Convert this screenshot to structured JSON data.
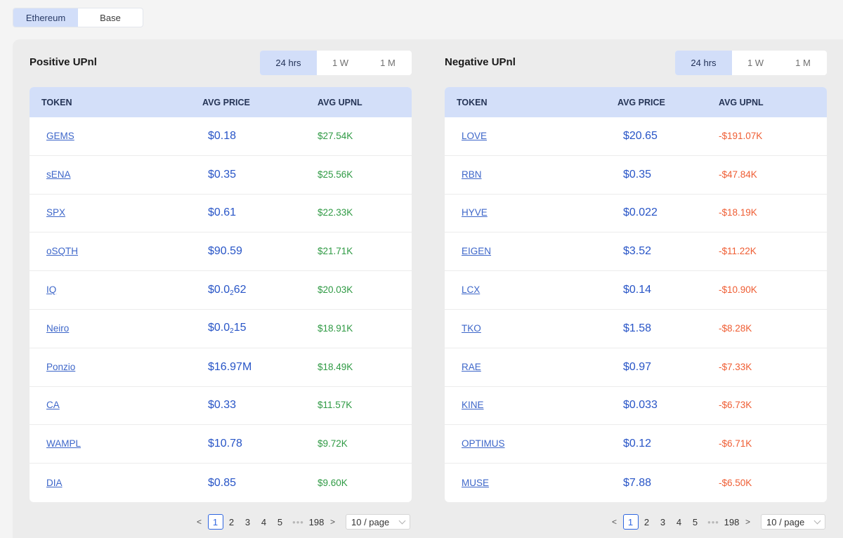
{
  "network_tabs": [
    {
      "label": "Ethereum",
      "active": true
    },
    {
      "label": "Base",
      "active": false
    }
  ],
  "positive": {
    "title": "Positive UPnl",
    "periods": [
      "24 hrs",
      "1 W",
      "1 M"
    ],
    "active_period": 0,
    "headers": {
      "token": "TOKEN",
      "price": "AVG PRICE",
      "upnl": "AVG UPNL"
    },
    "rows": [
      {
        "token": "GEMS",
        "price": "$0.18",
        "upnl": "$27.54K"
      },
      {
        "token": "sENA",
        "price": "$0.35",
        "upnl": "$25.56K"
      },
      {
        "token": "SPX",
        "price": "$0.61",
        "upnl": "$22.33K"
      },
      {
        "token": "oSQTH",
        "price": "$90.59",
        "upnl": "$21.71K"
      },
      {
        "token": "IQ",
        "price": "$0.0",
        "price_sub": "2",
        "price_tail": "62",
        "upnl": "$20.03K"
      },
      {
        "token": "Neiro",
        "price": "$0.0",
        "price_sub": "2",
        "price_tail": "15",
        "upnl": "$18.91K"
      },
      {
        "token": "Ponzio",
        "price": "$16.97M",
        "upnl": "$18.49K"
      },
      {
        "token": "CA",
        "price": "$0.33",
        "upnl": "$11.57K"
      },
      {
        "token": "WAMPL",
        "price": "$10.78",
        "upnl": "$9.72K"
      },
      {
        "token": "DIA",
        "price": "$0.85",
        "upnl": "$9.60K"
      }
    ],
    "pagination": {
      "prev": "<",
      "pages": [
        "1",
        "2",
        "3",
        "4",
        "5"
      ],
      "ellipsis": "•••",
      "last": "198",
      "next": ">",
      "page_size": "10 / page"
    }
  },
  "negative": {
    "title": "Negative UPnl",
    "periods": [
      "24 hrs",
      "1 W",
      "1 M"
    ],
    "active_period": 0,
    "headers": {
      "token": "TOKEN",
      "price": "AVG PRICE",
      "upnl": "AVG UPNL"
    },
    "rows": [
      {
        "token": "LOVE",
        "price": "$20.65",
        "upnl": "-$191.07K"
      },
      {
        "token": "RBN",
        "price": "$0.35",
        "upnl": "-$47.84K"
      },
      {
        "token": "HYVE",
        "price": "$0.022",
        "upnl": "-$18.19K"
      },
      {
        "token": "EIGEN",
        "price": "$3.52",
        "upnl": "-$11.22K"
      },
      {
        "token": "LCX",
        "price": "$0.14",
        "upnl": "-$10.90K"
      },
      {
        "token": "TKO",
        "price": "$1.58",
        "upnl": "-$8.28K"
      },
      {
        "token": "RAE",
        "price": "$0.97",
        "upnl": "-$7.33K"
      },
      {
        "token": "KINE",
        "price": "$0.033",
        "upnl": "-$6.73K"
      },
      {
        "token": "OPTIMUS",
        "price": "$0.12",
        "upnl": "-$6.71K"
      },
      {
        "token": "MUSE",
        "price": "$7.88",
        "upnl": "-$6.50K"
      }
    ],
    "pagination": {
      "prev": "<",
      "pages": [
        "1",
        "2",
        "3",
        "4",
        "5"
      ],
      "ellipsis": "•••",
      "last": "198",
      "next": ">",
      "page_size": "10 / page"
    }
  },
  "colors": {
    "accent": "#d2def9",
    "link": "#3d66c9",
    "price": "#2855c7",
    "positive": "#2f9a44",
    "negative": "#ef5d33"
  }
}
